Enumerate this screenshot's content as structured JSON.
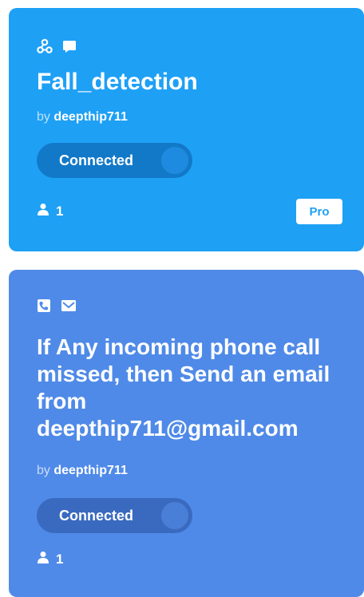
{
  "applets": [
    {
      "title": "Fall_detection",
      "by_prefix": "by",
      "author": "deepthip711",
      "status": "Connected",
      "users": "1",
      "badge": "Pro",
      "color": "#1ea0f5",
      "icons": [
        "webhooks-icon",
        "notification-icon"
      ]
    },
    {
      "title": "If Any incoming phone call missed, then Send an email from deepthip711@gmail.com",
      "by_prefix": "by",
      "author": "deepthip711",
      "status": "Connected",
      "users": "1",
      "color": "#4f8ae8",
      "icons": [
        "phone-call-icon",
        "email-icon"
      ]
    }
  ]
}
